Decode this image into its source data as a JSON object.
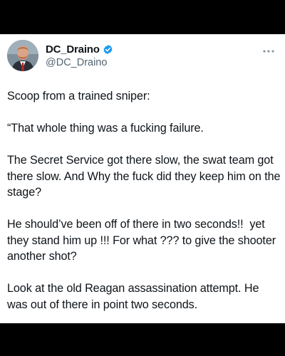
{
  "author": {
    "display_name": "DC_Draino",
    "handle": "@DC_Draino",
    "verified": true,
    "badge_color": "#1d9bf0"
  },
  "menu": {
    "icon": "more-horizontal-icon"
  },
  "tweet": {
    "paragraphs": [
      "Scoop from a trained sniper:",
      "“That whole thing was a fucking failure.",
      "The Secret Service got there slow, the swat team got there slow. And Why the fuck did they keep him on the stage?",
      "He should’ve been off of there in two seconds!!  yet they stand him up !!! For what ??? to give the shooter another shot?",
      "Look at the old Reagan assassination attempt. He was out of there in point two seconds."
    ]
  }
}
